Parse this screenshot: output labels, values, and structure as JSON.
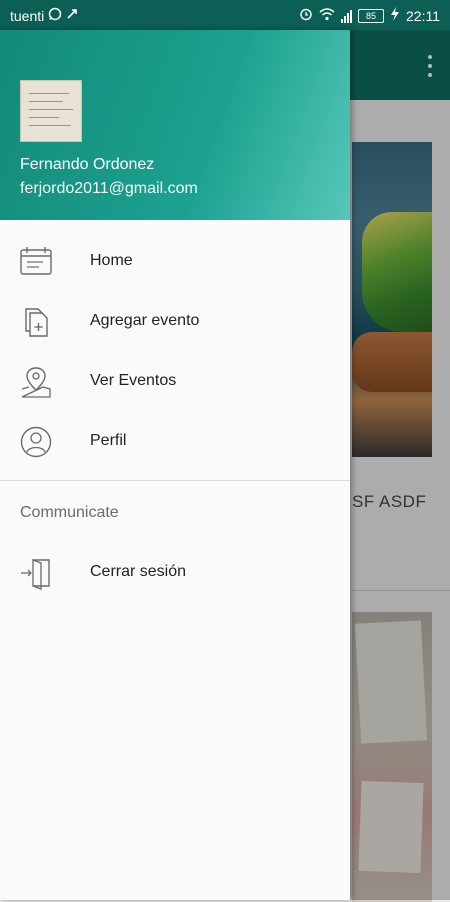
{
  "status_bar": {
    "carrier": "tuenti",
    "battery": "85",
    "time": "22:11"
  },
  "background_app": {
    "card_text": "SF ASDF"
  },
  "drawer": {
    "user_name": "Fernando Ordonez",
    "user_email": "ferjordo2011@gmail.com",
    "menu": [
      {
        "label": "Home",
        "icon": "calendar-icon"
      },
      {
        "label": "Agregar evento",
        "icon": "add-document-icon"
      },
      {
        "label": "Ver Eventos",
        "icon": "map-pin-icon"
      },
      {
        "label": "Perfil",
        "icon": "profile-icon"
      }
    ],
    "section_title": "Communicate",
    "logout": {
      "label": "Cerrar sesión",
      "icon": "logout-icon"
    }
  },
  "colors": {
    "primary": "#0e6e61",
    "header_start": "#138a78",
    "header_end": "#57c7b8"
  }
}
